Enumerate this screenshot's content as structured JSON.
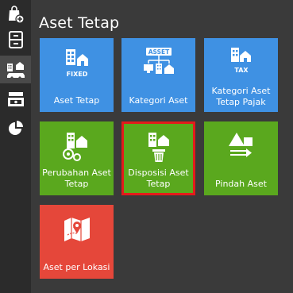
{
  "sidebar": {
    "items": [
      {
        "icon": "shopping-bag-add-icon"
      },
      {
        "icon": "cabinet-icon"
      },
      {
        "icon": "assets-car-icon",
        "active": true
      },
      {
        "icon": "money-cash-icon"
      },
      {
        "icon": "pie-chart-icon"
      }
    ]
  },
  "page": {
    "title": "Aset Tetap"
  },
  "tiles": [
    {
      "label": "Aset Tetap",
      "icon": "fixed-asset-icon",
      "color": "#3f91e3"
    },
    {
      "label": "Kategori Aset",
      "icon": "asset-category-icon",
      "color": "#3f91e3"
    },
    {
      "label": "Kategori Aset Tetap Pajak",
      "icon": "tax-asset-category-icon",
      "color": "#3f91e3"
    },
    {
      "label": "Perubahan Aset Tetap",
      "icon": "asset-change-icon",
      "color": "#5aa81e"
    },
    {
      "label": "Disposisi Aset Tetap",
      "icon": "asset-disposal-icon",
      "color": "#5aa81e",
      "selected": true
    },
    {
      "label": "Pindah Aset",
      "icon": "asset-transfer-icon",
      "color": "#5aa81e"
    },
    {
      "label": "Aset per Lokasi",
      "icon": "asset-location-map-icon",
      "color": "#e5473a"
    }
  ],
  "icon_text": {
    "fixed": "FIXED",
    "asset": "ASSET",
    "tax": "TAX"
  }
}
